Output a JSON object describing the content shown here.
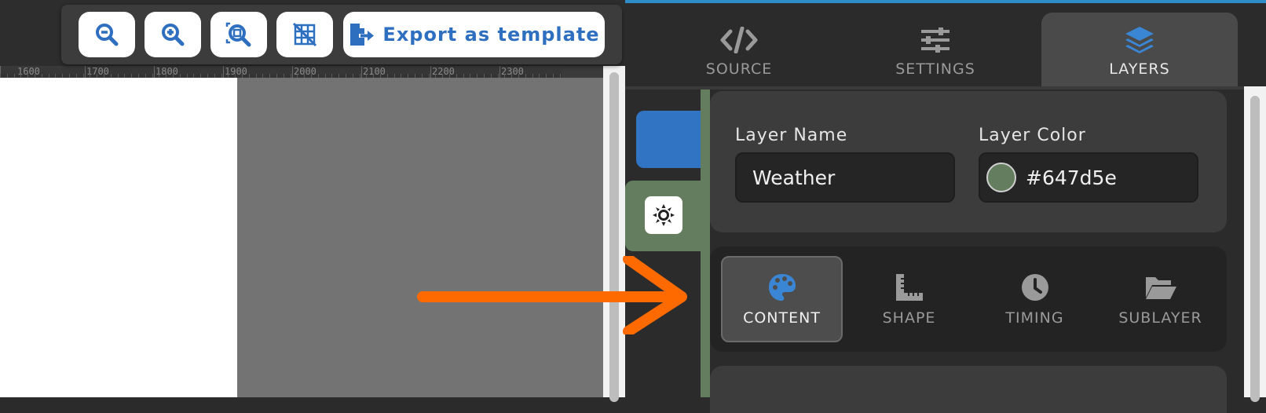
{
  "toolbar": {
    "buttons": [
      {
        "icon": "zoom-out-icon"
      },
      {
        "icon": "zoom-in-icon"
      },
      {
        "icon": "zoom-fit-icon"
      },
      {
        "icon": "grid-off-icon"
      }
    ],
    "export_label": "Export as template",
    "export_icon": "file-export-icon"
  },
  "ruler": {
    "labels": [
      "1600",
      "1700",
      "1800",
      "1900",
      "2000",
      "2100",
      "2200",
      "2300"
    ]
  },
  "tabs": [
    {
      "label": "SOURCE",
      "icon": "code-icon"
    },
    {
      "label": "SETTINGS",
      "icon": "sliders-icon"
    },
    {
      "label": "LAYERS",
      "icon": "layers-icon",
      "active": true
    }
  ],
  "layer": {
    "name_label": "Layer Name",
    "name_value": "Weather",
    "color_label": "Layer Color",
    "color_value": "#647d5e",
    "list_icon": "sun-icon"
  },
  "content_tabs": [
    {
      "label": "CONTENT",
      "icon": "palette-icon",
      "active": true
    },
    {
      "label": "SHAPE",
      "icon": "ruler-combined-icon"
    },
    {
      "label": "TIMING",
      "icon": "clock-icon"
    },
    {
      "label": "SUBLAYER",
      "icon": "folder-open-icon"
    }
  ],
  "colors": {
    "accent_blue": "#2f6fbf",
    "layer_green": "#647d5e",
    "arrow_orange": "#ff6a00",
    "top_bar": "#2e8cc7"
  }
}
